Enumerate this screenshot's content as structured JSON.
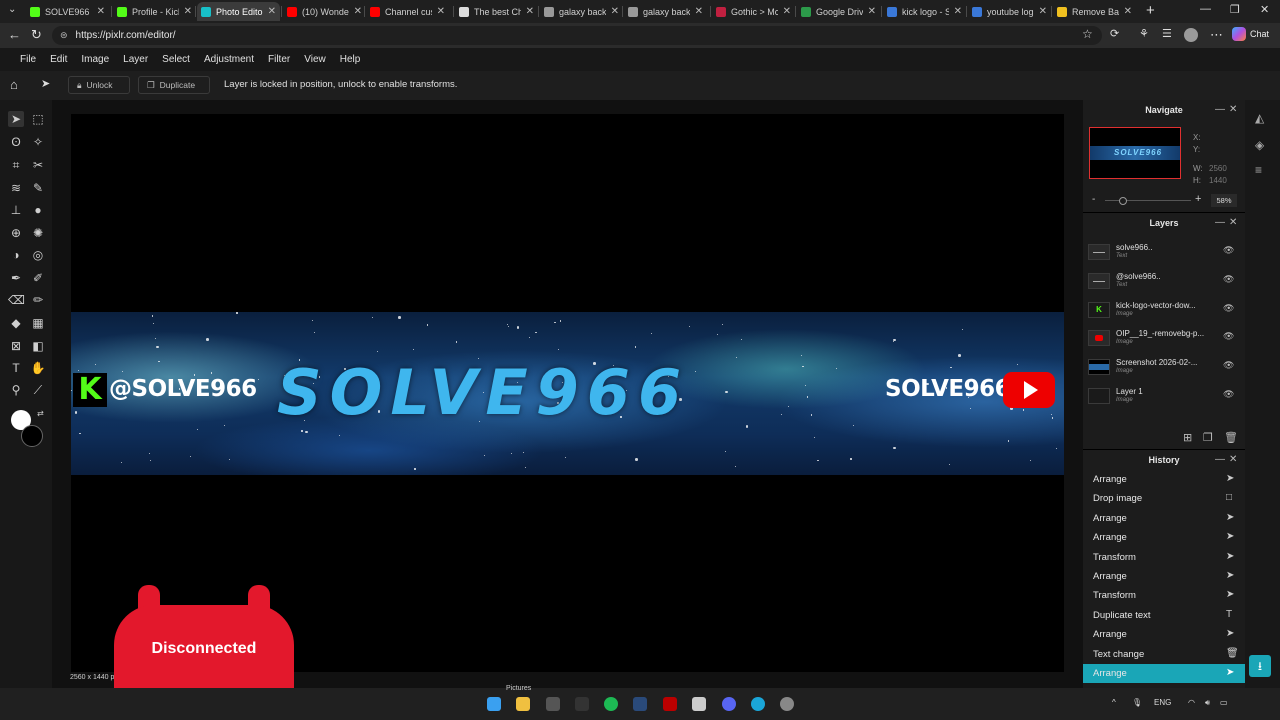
{
  "browser": {
    "tabs": [
      {
        "title": "SOLVE966 St",
        "favicon": "kick-favicon",
        "color": "#53fc18"
      },
      {
        "title": "Profile - Kick",
        "favicon": "kick-favicon",
        "color": "#53fc18"
      },
      {
        "title": "Photo Editor",
        "favicon": "pixlr-favicon",
        "color": "#18c0c8",
        "active": true
      },
      {
        "title": "(10) Wonder",
        "favicon": "youtube-favicon",
        "color": "#ff0000"
      },
      {
        "title": "Channel cus",
        "favicon": "youtube-favicon",
        "color": "#ff0000"
      },
      {
        "title": "The best Ch",
        "favicon": "site-favicon",
        "color": "#dddddd"
      },
      {
        "title": "galaxy back",
        "favicon": "search-favicon",
        "color": "#999999"
      },
      {
        "title": "galaxy back",
        "favicon": "search-favicon",
        "color": "#999999"
      },
      {
        "title": "Gothic > Mc",
        "favicon": "site-favicon",
        "color": "#c02040"
      },
      {
        "title": "Google Drive",
        "favicon": "drive-favicon",
        "color": "#2c9a4a"
      },
      {
        "title": "kick logo - S",
        "favicon": "search-favicon",
        "color": "#3a78d8"
      },
      {
        "title": "youtube log",
        "favicon": "search-favicon",
        "color": "#3a78d8"
      },
      {
        "title": "Remove Bac",
        "favicon": "site-favicon",
        "color": "#f0c020"
      }
    ],
    "url": "https://pixlr.com/editor/",
    "new_tab": "+"
  },
  "menu": [
    "File",
    "Edit",
    "Image",
    "Layer",
    "Select",
    "Adjustment",
    "Filter",
    "View",
    "Help"
  ],
  "options": {
    "unlock": "Unlock",
    "duplicate": "Duplicate",
    "message": "Layer is locked in position, unlock to enable transforms."
  },
  "canvas": {
    "title_text": "SOLVE966",
    "handle_left": "@SOLVE966",
    "handle_right": "SOLVE966",
    "kick_glyph": "K",
    "dimensions": "2560 x 1440 px"
  },
  "navigate": {
    "title": "Navigate",
    "x_label": "X:",
    "y_label": "Y:",
    "w_label": "W:",
    "h_label": "H:",
    "w_value": "2560",
    "h_value": "1440",
    "zoom": "58%",
    "thumb_text": "SOLVE966",
    "minus": "-",
    "plus": "+"
  },
  "layers": {
    "title": "Layers",
    "items": [
      {
        "name": "solve966..",
        "type": "Text"
      },
      {
        "name": "@solve966..",
        "type": "Text"
      },
      {
        "name": "kick-logo-vector-dow...",
        "type": "Image"
      },
      {
        "name": "OIP__19_-removebg-p...",
        "type": "Image"
      },
      {
        "name": "Screenshot 2026-02-...",
        "type": "Image"
      },
      {
        "name": "Layer 1",
        "type": "Image"
      }
    ]
  },
  "history": {
    "title": "History",
    "items": [
      {
        "name": "Arrange",
        "icon": "arrow-icon"
      },
      {
        "name": "Drop image",
        "icon": "square-icon"
      },
      {
        "name": "Arrange",
        "icon": "arrow-icon"
      },
      {
        "name": "Arrange",
        "icon": "arrow-icon"
      },
      {
        "name": "Transform",
        "icon": "arrow-icon"
      },
      {
        "name": "Arrange",
        "icon": "arrow-icon"
      },
      {
        "name": "Transform",
        "icon": "arrow-icon"
      },
      {
        "name": "Duplicate text",
        "icon": "text-icon"
      },
      {
        "name": "Arrange",
        "icon": "arrow-icon"
      },
      {
        "name": "Text change",
        "icon": "trash-icon"
      },
      {
        "name": "Arrange",
        "icon": "arrow-icon",
        "selected": true
      }
    ]
  },
  "overlay": {
    "text": "Disconnected"
  },
  "chat_label": "Chat",
  "taskbar": {
    "lang": "ENG",
    "search_label": "Pictures"
  },
  "colors": {
    "accent": "#1aa6b7",
    "title_blue": "#3fb6ee",
    "kick_green": "#53fc18",
    "youtube_red": "#ff0000",
    "overlay_red": "#e3182c"
  }
}
